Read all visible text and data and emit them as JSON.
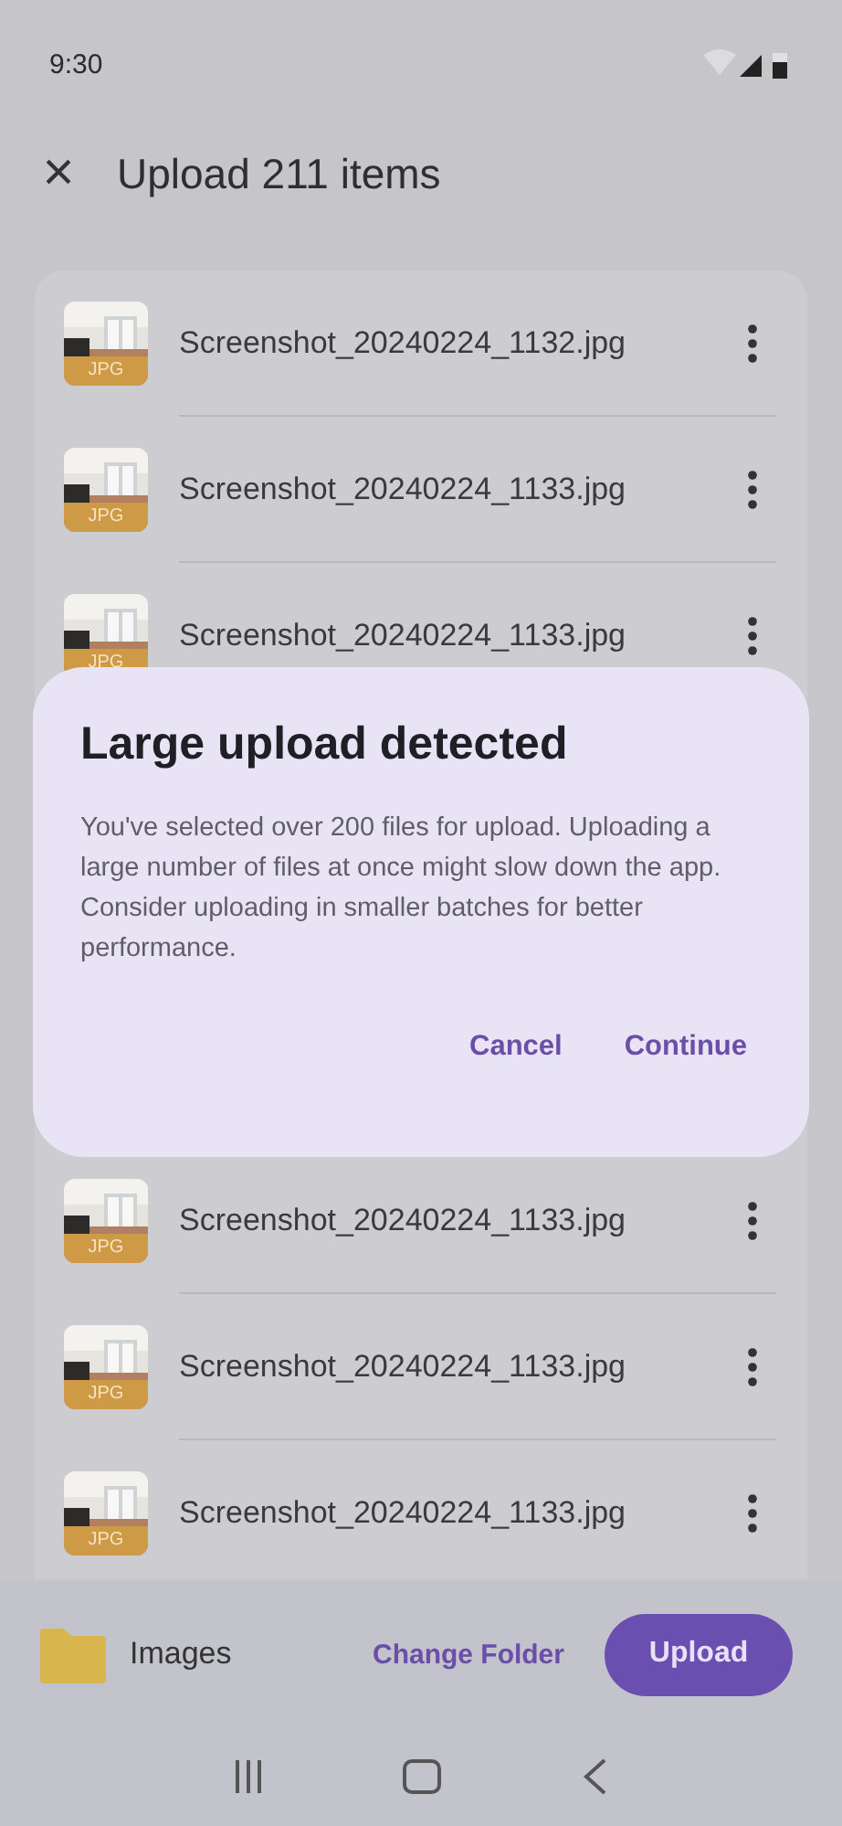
{
  "status_bar": {
    "time": "9:30"
  },
  "app_bar": {
    "close_icon": "×",
    "title": "Upload 211 items"
  },
  "files": [
    {
      "name": "Screenshot_20240224_1132.jpg",
      "badge": "JPG",
      "kind": "picture"
    },
    {
      "name": "Screenshot_20240224_1133.jpg",
      "badge": "JPG",
      "kind": "picture"
    },
    {
      "name": "Screenshot_20240224_1133.jpg",
      "badge": "JPG",
      "kind": "picture"
    },
    {
      "name": "Screenshot_20240224_1133.jpg",
      "badge": "JPG",
      "kind": "picture"
    },
    {
      "name": "Screenshot_20240224_1133.jpg",
      "badge": "JPG",
      "kind": "picture"
    },
    {
      "name": "Screenshot_20240224_1133.jpg",
      "badge": "JPG",
      "kind": "picture"
    }
  ],
  "dialog": {
    "title": "Large upload detected",
    "message": "You've selected over 200 files for upload. Uploading a large number of files at once might slow down the app. Consider uploading in smaller batches for better performance.",
    "buttons": [
      "Cancel",
      "Continue"
    ]
  },
  "bottom_bar": {
    "folder": "Images",
    "change_button": "Change Folder",
    "upload_button": "Upload"
  }
}
